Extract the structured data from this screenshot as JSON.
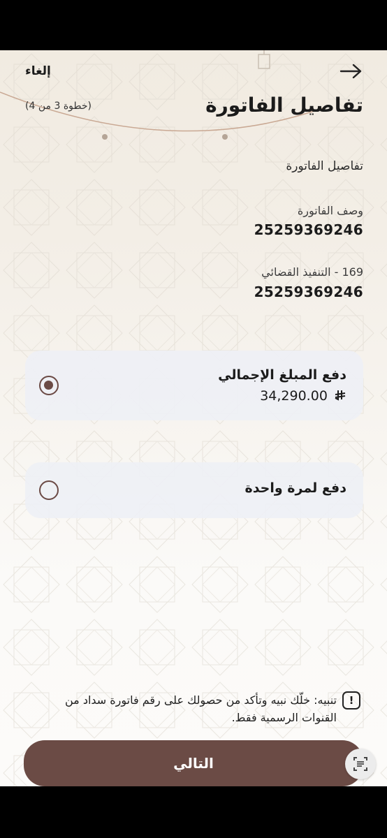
{
  "header": {
    "cancel_label": "إلغاء",
    "title": "تفاصيل الفاتورة",
    "step": "(خطوة 3 من 4)",
    "back_icon": "arrow-right-icon"
  },
  "details": {
    "section_title": "تفاصيل الفاتورة",
    "fields": [
      {
        "label": "وصف الفاتورة",
        "value": "25259369246"
      },
      {
        "label": "169 - التنفيذ القضائي",
        "value": "25259369246"
      }
    ]
  },
  "options": [
    {
      "title": "دفع المبلغ الإجمالي",
      "amount": "34,290.00",
      "currency_symbol": "⃁",
      "selected": true
    },
    {
      "title": "دفع لمرة واحدة",
      "selected": false
    }
  ],
  "notice": {
    "text": "تنبيه: خلّك نبيه وتأكد من حصولك على رقم فاتورة سداد من القنوات الرسمية فقط.",
    "icon": "exclamation-icon"
  },
  "footer": {
    "next_label": "التالي",
    "scan_icon": "scan-text-icon"
  },
  "colors": {
    "primary": "#6b4b45",
    "card_bg": "#eef0f5",
    "background": "#f1ebe1"
  }
}
